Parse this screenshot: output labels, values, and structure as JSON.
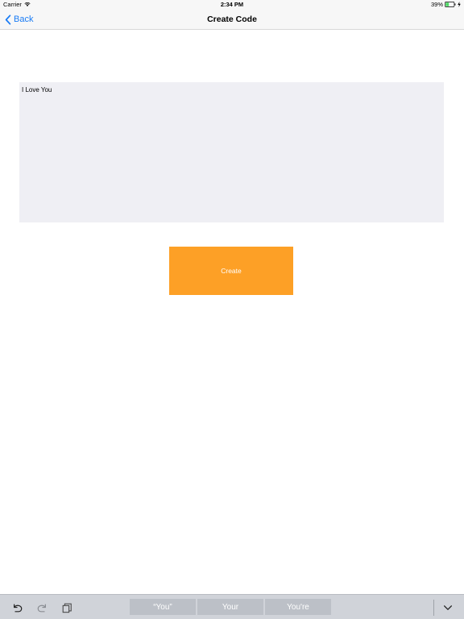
{
  "status_bar": {
    "carrier": "Carrier",
    "time": "2:34 PM",
    "battery": "39%",
    "icons": [
      "wifi-icon",
      "battery-icon",
      "charging-bolt-icon"
    ]
  },
  "nav": {
    "back_label": "Back",
    "back_icon": "chevron-left-icon",
    "title": "Create Code"
  },
  "message": {
    "value": "I Love You"
  },
  "create_button": {
    "label": "Create"
  },
  "keyboard": {
    "tools": [
      "undo-icon",
      "redo-icon",
      "paste-icon"
    ],
    "suggestions": [
      "“You”",
      "Your",
      "You're"
    ],
    "dismiss_icon": "chevron-down-icon"
  },
  "colors": {
    "accent": "#1a7cf5",
    "button": "#fda026",
    "text_area_bg": "#efeff4",
    "keyboard_bg": "#d0d3d9",
    "suggestion_bg": "#bcc0c7"
  }
}
